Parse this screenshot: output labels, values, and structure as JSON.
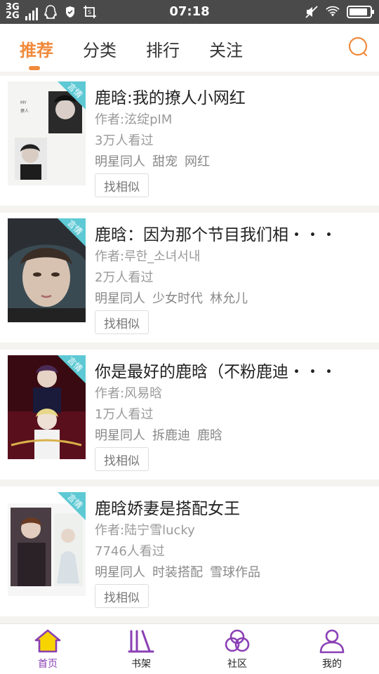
{
  "status_bar": {
    "network_top": "3G",
    "network_bottom": "2G",
    "time": "07:18",
    "icons": [
      "qq-icon",
      "shield-icon",
      "screenshot-icon",
      "mute-icon",
      "wifi-icon",
      "battery-icon"
    ],
    "battery_level": 0.9
  },
  "top_nav": {
    "tabs": [
      {
        "label": "推荐",
        "active": true
      },
      {
        "label": "分类",
        "active": false
      },
      {
        "label": "排行",
        "active": false
      },
      {
        "label": "关注",
        "active": false
      }
    ],
    "accent_color": "#f08a3c"
  },
  "books": [
    {
      "ribbon": "言情",
      "title": "鹿晗:我的撩人小网红",
      "author": "作者:泫绽pIM",
      "views": "3万人看过",
      "tags": [
        "明星同人",
        "甜宠",
        "网红"
      ],
      "action": "找相似"
    },
    {
      "ribbon": "言情",
      "title": "鹿晗：因为那个节目我们相・・・",
      "author": "作者:루한_소녀서내",
      "views": "2万人看过",
      "tags": [
        "明星同人",
        "少女时代",
        "林允儿"
      ],
      "action": "找相似"
    },
    {
      "ribbon": "言情",
      "title": "你是最好的鹿晗（不粉鹿迪・・・",
      "author": "作者:风易晗",
      "views": "1万人看过",
      "tags": [
        "明星同人",
        "拆鹿迪",
        "鹿晗"
      ],
      "action": "找相似"
    },
    {
      "ribbon": "言情",
      "title": "鹿晗娇妻是搭配女王",
      "author": "作者:陆宁雪lucky",
      "views": "7746人看过",
      "tags": [
        "明星同人",
        "时装搭配",
        "雪球作品"
      ],
      "action": "找相似"
    }
  ],
  "bottom_nav": {
    "items": [
      {
        "label": "首页",
        "icon": "home-icon",
        "active": true
      },
      {
        "label": "书架",
        "icon": "bookshelf-icon",
        "active": false
      },
      {
        "label": "社区",
        "icon": "community-icon",
        "active": false
      },
      {
        "label": "我的",
        "icon": "profile-icon",
        "active": false
      }
    ],
    "active_color": "#8a3fb4"
  }
}
